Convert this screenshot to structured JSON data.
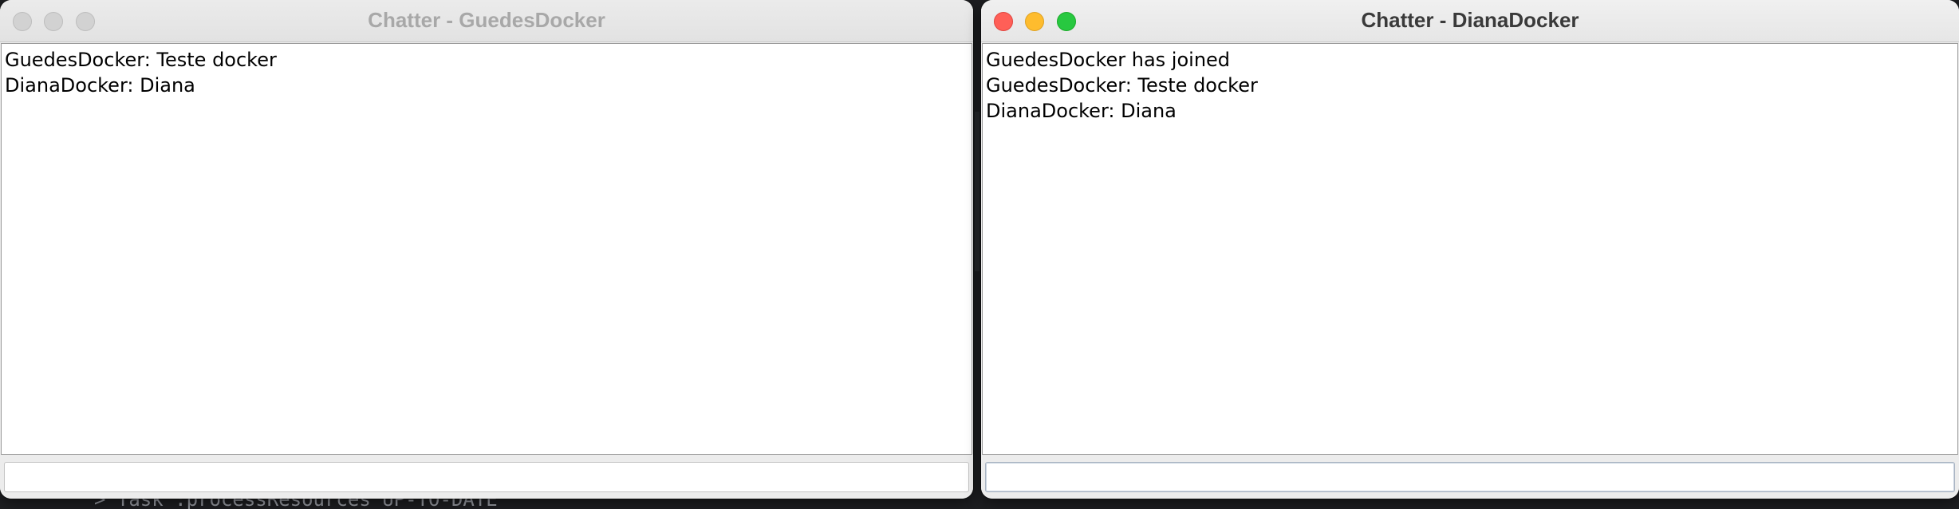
{
  "background": {
    "terminal_text": "> Task :processResources UP-TO-DATE"
  },
  "windows": [
    {
      "title": "Chatter - GuedesDocker",
      "active": false,
      "messages": [
        "GuedesDocker: Teste docker",
        "DianaDocker: Diana"
      ],
      "input_value": ""
    },
    {
      "title": "Chatter - DianaDocker",
      "active": true,
      "messages": [
        "GuedesDocker has joined",
        "GuedesDocker: Teste docker",
        "DianaDocker: Diana"
      ],
      "input_value": ""
    }
  ],
  "colors": {
    "close": "#ff5f57",
    "minimize": "#febc2e",
    "zoom": "#28c840",
    "inactive_traffic": "#d2d2d2"
  }
}
